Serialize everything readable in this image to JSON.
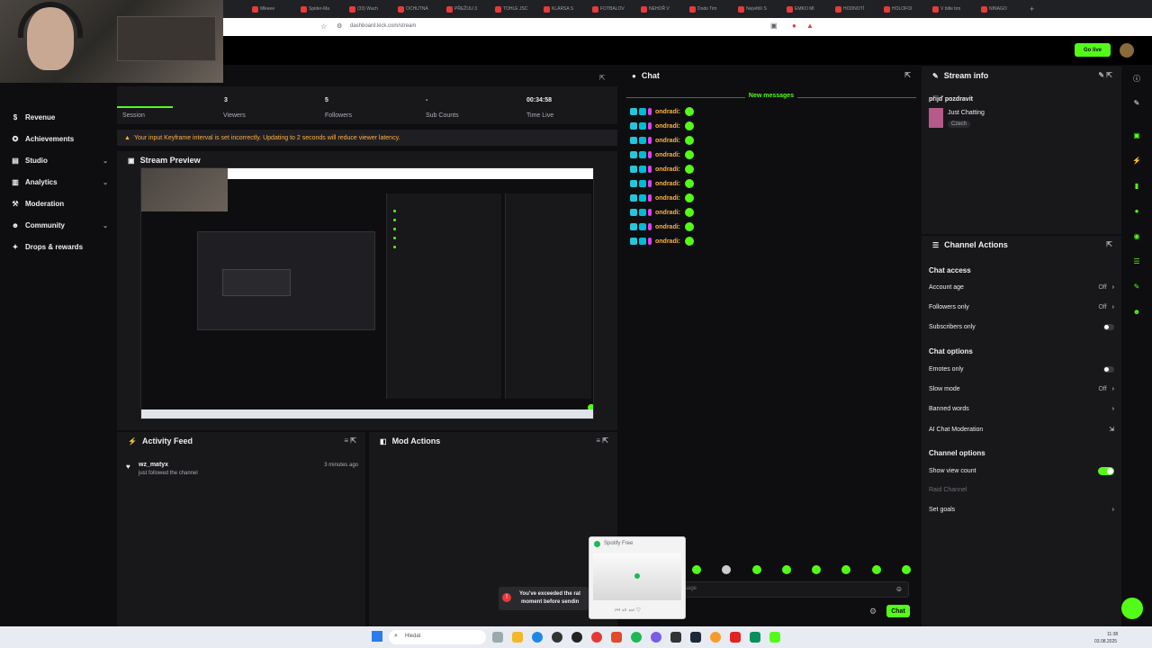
{
  "browser": {
    "tabs": [
      "Mikeee",
      "Spider-Ma",
      "(33) Wach",
      "OCHUTNÁ",
      "PŘEŽIJU 3",
      "TOHLE JSC",
      "KLÁRSA S",
      "FOTBALOV",
      "NEHOŘ V",
      "Dodo Tim",
      "Největší S",
      "EMKO MI",
      "HODNOTÍ",
      "HOLOFOI",
      "V bitle bm",
      "NINAGO"
    ],
    "new_tab": "+",
    "url": "dashboard.kick.com/stream"
  },
  "topbar": {
    "go_live_label": "Go live"
  },
  "sidebar": {
    "items": [
      {
        "label": "Revenue",
        "icon": "dollar-icon"
      },
      {
        "label": "Achievements",
        "icon": "medal-icon"
      },
      {
        "label": "Studio",
        "icon": "film-icon",
        "chevron": "⌄"
      },
      {
        "label": "Analytics",
        "icon": "chart-icon",
        "chevron": "⌄"
      },
      {
        "label": "Moderation",
        "icon": "gavel-icon"
      },
      {
        "label": "Community",
        "icon": "users-icon",
        "chevron": "⌄"
      },
      {
        "label": "Drops & rewards",
        "icon": "gift-icon"
      }
    ]
  },
  "stats": {
    "session_label": "Session",
    "viewers_value": "3",
    "viewers_label": "Viewers",
    "followers_value": "5",
    "followers_label": "Followers",
    "subs_value": "-",
    "subs_label": "Sub Counts",
    "time_value": "00:34:58",
    "time_label": "Time Live"
  },
  "warning": {
    "text": "Your input Keyframe interval is set incorrectly. Updating to 2 seconds will reduce viewer latency."
  },
  "preview": {
    "title": "Stream Preview"
  },
  "activity": {
    "title": "Activity Feed",
    "items": [
      {
        "user": "wz_matyx",
        "text": "just followed the channel",
        "time": "3 minutes ago"
      }
    ]
  },
  "mod_actions": {
    "title": "Mod Actions"
  },
  "chat": {
    "title": "Chat",
    "new_messages": "New messages",
    "messages": [
      {
        "user": "ondradi:"
      },
      {
        "user": "ondradi:"
      },
      {
        "user": "ondradi:"
      },
      {
        "user": "ondradi:"
      },
      {
        "user": "ondradi:"
      },
      {
        "user": "ondradi:"
      },
      {
        "user": "ondradi:"
      },
      {
        "user": "ondradi:"
      },
      {
        "user": "ondradi:"
      },
      {
        "user": "ondradi:"
      }
    ],
    "input_placeholder": "sage",
    "send_label": "Chat"
  },
  "stream_info": {
    "title": "Stream info",
    "stream_title": "přijď pozdravit",
    "category": "Just Chatting",
    "language": "Czech"
  },
  "channel_actions": {
    "title": "Channel Actions",
    "chat_access": "Chat access",
    "account_age": "Account age",
    "account_age_val": "Off",
    "followers_only": "Followers only",
    "followers_only_val": "Off",
    "subscribers_only": "Subscribers only",
    "chat_options": "Chat options",
    "emotes_only": "Emotes only",
    "slow_mode": "Slow mode",
    "slow_mode_val": "Off",
    "banned_words": "Banned words",
    "ai_moderation": "AI Chat Moderation",
    "channel_options": "Channel options",
    "show_view_count": "Show view count",
    "raid_channel": "Raid Channel",
    "set_goals": "Set goals"
  },
  "toast": {
    "line1": "You've exceeded the rat",
    "line2": "moment before sendin"
  },
  "spotify": {
    "title": "Spotify Free"
  },
  "taskbar": {
    "search_placeholder": "Hledat",
    "time": "11:38",
    "date": "03.08.2025"
  },
  "colors": {
    "accent": "#53fc18",
    "warning": "#ffb23f",
    "panel": "#18181b",
    "bg": "#0e0e10"
  }
}
